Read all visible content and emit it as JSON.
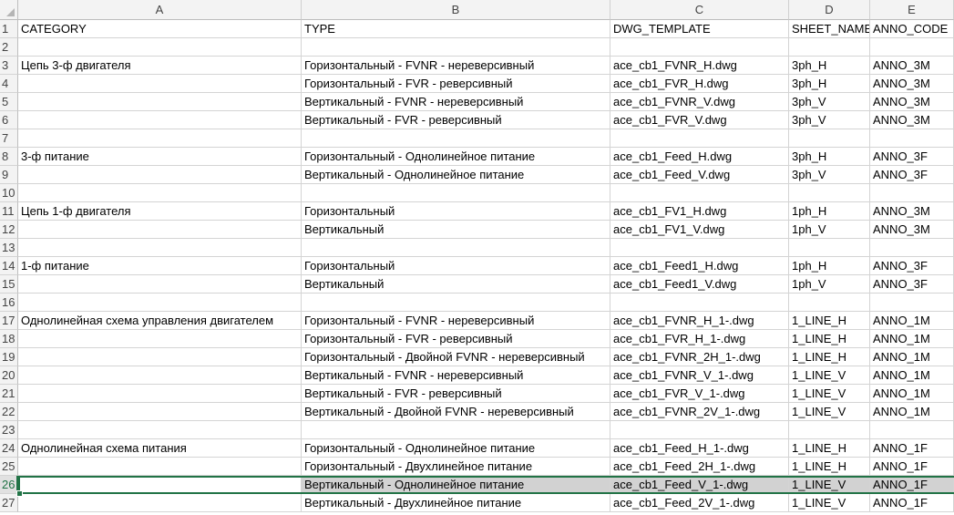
{
  "columns": [
    {
      "letter": "A",
      "width": 311
    },
    {
      "letter": "B",
      "width": 339
    },
    {
      "letter": "C",
      "width": 196
    },
    {
      "letter": "D",
      "width": 89
    },
    {
      "letter": "E",
      "width": 92
    }
  ],
  "selected_row": 26,
  "rows": [
    {
      "n": "1",
      "cells": [
        "CATEGORY",
        "TYPE",
        "DWG_TEMPLATE",
        "SHEET_NAME",
        "ANNO_CODE"
      ]
    },
    {
      "n": "2",
      "cells": [
        "",
        "",
        "",
        "",
        ""
      ]
    },
    {
      "n": "3",
      "cells": [
        "Цепь 3-ф двигателя",
        "Горизонтальный - FVNR - нереверсивный",
        "ace_cb1_FVNR_H.dwg",
        "3ph_H",
        "ANNO_3M"
      ]
    },
    {
      "n": "4",
      "cells": [
        "",
        "Горизонтальный - FVR - реверсивный",
        "ace_cb1_FVR_H.dwg",
        "3ph_H",
        "ANNO_3M"
      ]
    },
    {
      "n": "5",
      "cells": [
        "",
        "Вертикальный - FVNR - нереверсивный",
        "ace_cb1_FVNR_V.dwg",
        "3ph_V",
        "ANNO_3M"
      ]
    },
    {
      "n": "6",
      "cells": [
        "",
        "Вертикальный - FVR - реверсивный",
        "ace_cb1_FVR_V.dwg",
        "3ph_V",
        "ANNO_3M"
      ]
    },
    {
      "n": "7",
      "cells": [
        "",
        "",
        "",
        "",
        ""
      ]
    },
    {
      "n": "8",
      "cells": [
        "3-ф питание",
        "Горизонтальный - Однолинейное питание",
        "ace_cb1_Feed_H.dwg",
        "3ph_H",
        "ANNO_3F"
      ]
    },
    {
      "n": "9",
      "cells": [
        "",
        "Вертикальный - Однолинейное питание",
        "ace_cb1_Feed_V.dwg",
        "3ph_V",
        "ANNO_3F"
      ]
    },
    {
      "n": "10",
      "cells": [
        "",
        "",
        "",
        "",
        ""
      ]
    },
    {
      "n": "11",
      "cells": [
        "Цепь 1-ф двигателя",
        "Горизонтальный",
        "ace_cb1_FV1_H.dwg",
        "1ph_H",
        "ANNO_3M"
      ]
    },
    {
      "n": "12",
      "cells": [
        "",
        "Вертикальный",
        "ace_cb1_FV1_V.dwg",
        "1ph_V",
        "ANNO_3M"
      ]
    },
    {
      "n": "13",
      "cells": [
        "",
        "",
        "",
        "",
        ""
      ]
    },
    {
      "n": "14",
      "cells": [
        "1-ф питание",
        "Горизонтальный",
        "ace_cb1_Feed1_H.dwg",
        "1ph_H",
        "ANNO_3F"
      ]
    },
    {
      "n": "15",
      "cells": [
        "",
        "Вертикальный",
        "ace_cb1_Feed1_V.dwg",
        "1ph_V",
        "ANNO_3F"
      ]
    },
    {
      "n": "16",
      "cells": [
        "",
        "",
        "",
        "",
        ""
      ]
    },
    {
      "n": "17",
      "cells": [
        "Однолинейная схема управления двигателем",
        "Горизонтальный - FVNR - нереверсивный",
        "ace_cb1_FVNR_H_1-.dwg",
        "1_LINE_H",
        "ANNO_1M"
      ]
    },
    {
      "n": "18",
      "cells": [
        "",
        "Горизонтальный - FVR - реверсивный",
        "ace_cb1_FVR_H_1-.dwg",
        "1_LINE_H",
        "ANNO_1M"
      ]
    },
    {
      "n": "19",
      "cells": [
        "",
        "Горизонтальный - Двойной FVNR - нереверсивный",
        "ace_cb1_FVNR_2H_1-.dwg",
        "1_LINE_H",
        "ANNO_1M"
      ]
    },
    {
      "n": "20",
      "cells": [
        "",
        "Вертикальный - FVNR - нереверсивный",
        "ace_cb1_FVNR_V_1-.dwg",
        "1_LINE_V",
        "ANNO_1M"
      ]
    },
    {
      "n": "21",
      "cells": [
        "",
        "Вертикальный - FVR - реверсивный",
        "ace_cb1_FVR_V_1-.dwg",
        "1_LINE_V",
        "ANNO_1M"
      ]
    },
    {
      "n": "22",
      "cells": [
        "",
        "Вертикальный - Двойной FVNR - нереверсивный",
        "ace_cb1_FVNR_2V_1-.dwg",
        "1_LINE_V",
        "ANNO_1M"
      ]
    },
    {
      "n": "23",
      "cells": [
        "",
        "",
        "",
        "",
        ""
      ]
    },
    {
      "n": "24",
      "cells": [
        "Однолинейная схема питания",
        "Горизонтальный - Однолинейное питание",
        "ace_cb1_Feed_H_1-.dwg",
        "1_LINE_H",
        "ANNO_1F"
      ]
    },
    {
      "n": "25",
      "cells": [
        "",
        "Горизонтальный - Двухлинейное питание",
        "ace_cb1_Feed_2H_1-.dwg",
        "1_LINE_H",
        "ANNO_1F"
      ]
    },
    {
      "n": "26",
      "cells": [
        "",
        "Вертикальный - Однолинейное питание",
        "ace_cb1_Feed_V_1-.dwg",
        "1_LINE_V",
        "ANNO_1F"
      ]
    },
    {
      "n": "27",
      "cells": [
        "",
        "Вертикальный - Двухлинейное питание",
        "ace_cb1_Feed_2V_1-.dwg",
        "1_LINE_V",
        "ANNO_1F"
      ]
    }
  ]
}
